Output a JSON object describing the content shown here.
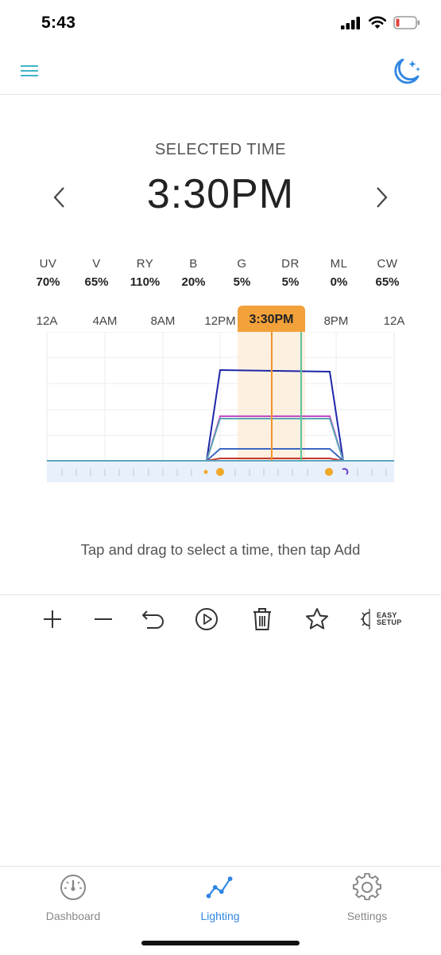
{
  "status_bar": {
    "time": "5:43"
  },
  "header": {
    "menu_icon": "hamburger-menu-icon",
    "mode_icon": "moon-stars-icon"
  },
  "selection": {
    "label": "SELECTED TIME",
    "time": "3:30PM",
    "prev_icon": "chevron-left-icon",
    "next_icon": "chevron-right-icon"
  },
  "channels": [
    {
      "name": "UV",
      "value": "70%"
    },
    {
      "name": "V",
      "value": "65%"
    },
    {
      "name": "RY",
      "value": "110%"
    },
    {
      "name": "B",
      "value": "20%"
    },
    {
      "name": "G",
      "value": "5%"
    },
    {
      "name": "DR",
      "value": "5%"
    },
    {
      "name": "ML",
      "value": "0%"
    },
    {
      "name": "CW",
      "value": "65%"
    }
  ],
  "time_axis": {
    "labels": [
      "12A",
      "4AM",
      "8AM",
      "12PM",
      "8PM",
      "12A"
    ],
    "selected_label": "3:30PM"
  },
  "hint": "Tap and drag to select a time, then tap Add",
  "toolbar": {
    "icons": [
      "add-icon",
      "remove-icon",
      "undo-icon",
      "play-icon",
      "trash-icon",
      "favorite-star-icon",
      "easy-setup-icon"
    ],
    "easy_setup_line1": "EASY",
    "easy_setup_line2": "SETUP"
  },
  "tabs": [
    {
      "label": "Dashboard",
      "icon": "gauge-icon",
      "active": false
    },
    {
      "label": "Lighting",
      "icon": "line-chart-icon",
      "active": true
    },
    {
      "label": "Settings",
      "icon": "gear-icon",
      "active": false
    }
  ],
  "colors": {
    "accent": "#2f86e3",
    "header_teal": "#3fb4c8",
    "selection_orange": "#f3a13b",
    "green_marker": "#5cc29a"
  }
}
